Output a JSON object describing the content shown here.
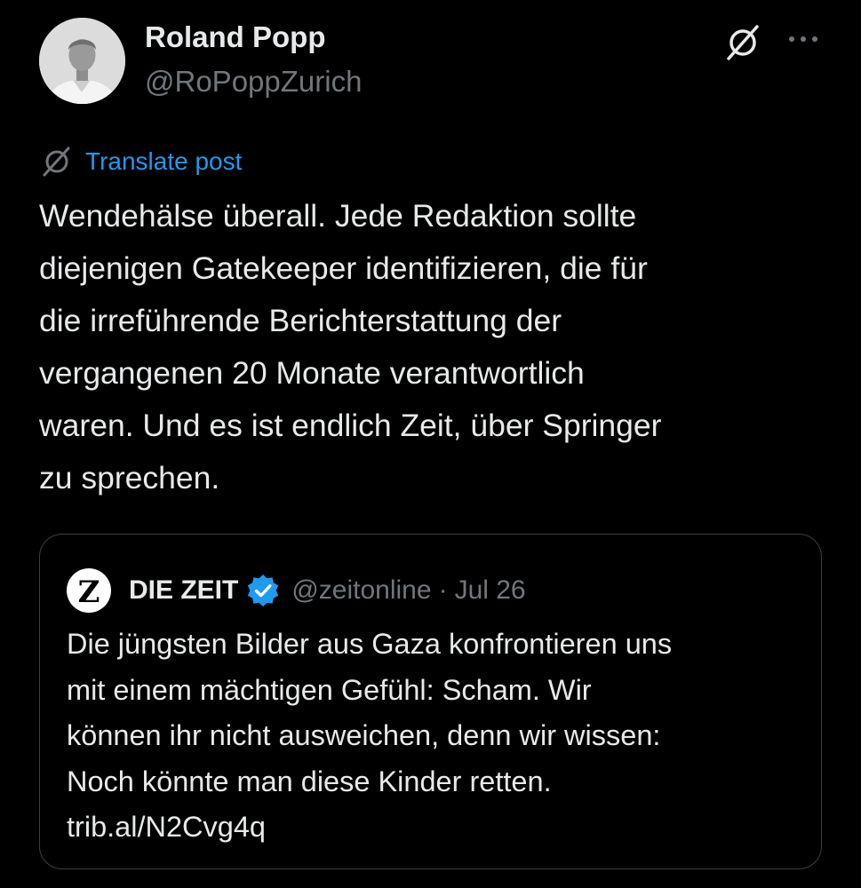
{
  "author": {
    "display_name": "Roland Popp",
    "handle": "@RoPoppZurich"
  },
  "header_actions": {
    "grok_icon": "grok-slash-circle-icon",
    "more_icon": "more-horizontal-icon"
  },
  "translate": {
    "label": "Translate post",
    "icon": "grok-slash-circle-icon"
  },
  "post": {
    "lines": [
      "Wendehälse überall. Jede Redaktion sollte",
      "diejenigen Gatekeeper identifizieren, die für",
      "die irreführende Berichterstattung der",
      "vergangenen 20 Monate verantwortlich",
      "waren. Und es ist endlich Zeit, über Springer",
      "zu sprechen."
    ]
  },
  "quoted_post": {
    "avatar_letter": "Z",
    "name": "DIE ZEIT",
    "handle": "@zeitonline",
    "separator": "·",
    "date": "Jul 26",
    "lines": [
      "Die jüngsten Bilder aus Gaza konfrontieren uns",
      "mit einem mächtigen Gefühl: Scham. Wir",
      "können ihr nicht ausweichen, denn wir wissen:",
      "Noch könnte man diese Kinder retten.",
      "trib.al/N2Cvg4q"
    ]
  },
  "colors": {
    "background": "#000000",
    "text_primary": "#e7e9ea",
    "text_secondary": "#71767b",
    "link": "#1d9bf0",
    "border": "#3a3f44",
    "verified": "#1d9bf0"
  }
}
